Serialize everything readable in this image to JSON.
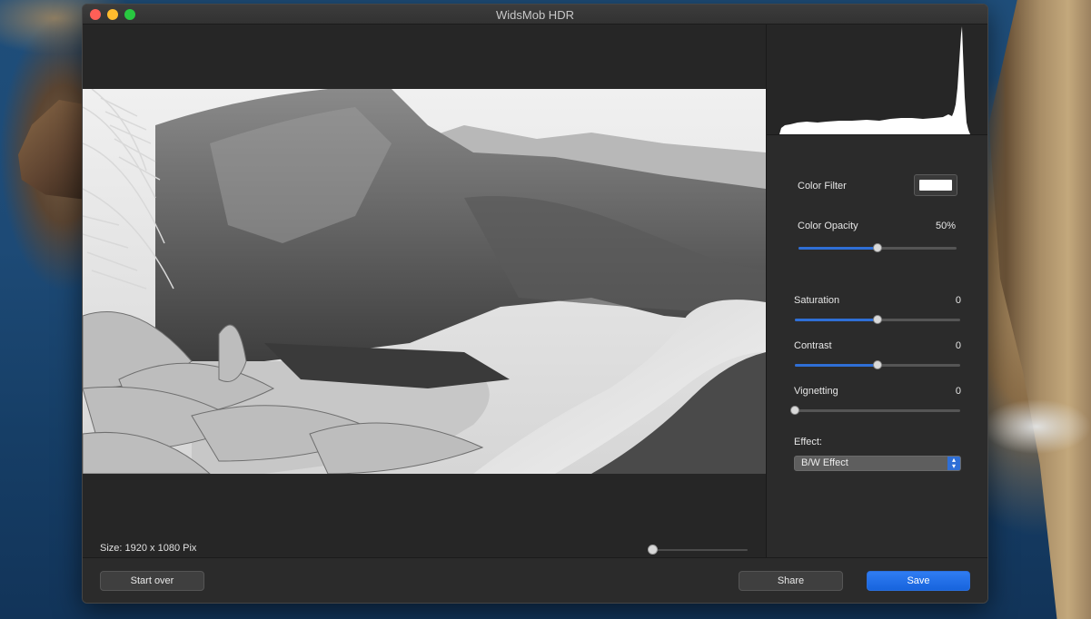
{
  "window": {
    "title": "WidsMob HDR"
  },
  "canvas": {
    "size_label": "Size: 1920 x 1080 Pix",
    "zoom_level": 0
  },
  "panel": {
    "color_filter": {
      "label": "Color Filter",
      "color": "#ffffff"
    },
    "color_opacity": {
      "label": "Color Opacity",
      "value": "50%",
      "level": 0.5
    },
    "saturation": {
      "label": "Saturation",
      "value": "0",
      "level": 0.5
    },
    "contrast": {
      "label": "Contrast",
      "value": "0",
      "level": 0.5
    },
    "vignetting": {
      "label": "Vignetting",
      "value": "0",
      "level": 0
    },
    "effect": {
      "label": "Effect:",
      "selected": "B/W Effect"
    }
  },
  "footer": {
    "start_over_label": "Start over",
    "share_label": "Share",
    "save_label": "Save"
  },
  "colors": {
    "accent": "#2f6fd6",
    "primary_button": "#1a6ae8",
    "window_bg": "#2a2a2a"
  },
  "icons": {
    "select_arrows": "chevron-up-down-icon"
  }
}
